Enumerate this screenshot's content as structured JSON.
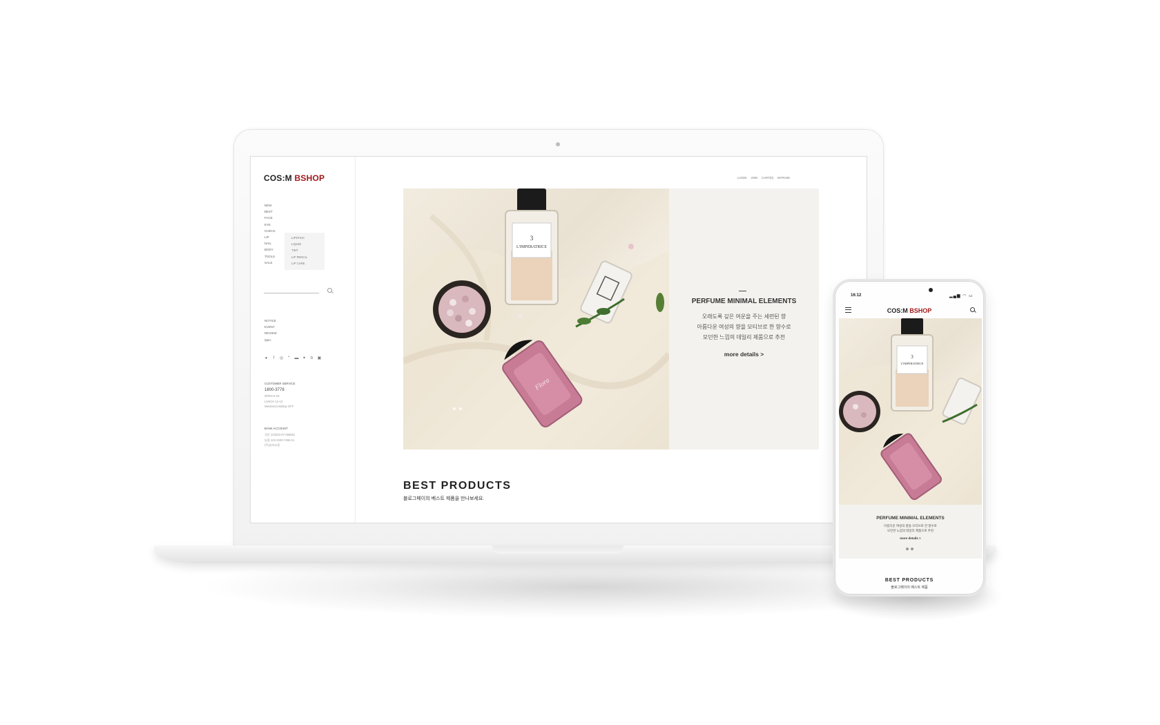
{
  "brand": {
    "part1": "COS:M ",
    "part2": "BSHOP",
    "accent": "#a01818"
  },
  "sidebar": {
    "nav": [
      "NEW",
      "BEST",
      "FACE",
      "EYE",
      "CHECK",
      "LIP",
      "NAIL",
      "BODY",
      "TOOLS",
      "SALE"
    ],
    "lip_submenu": [
      "LIPSTICK",
      "LIQUID",
      "TINT",
      "LIP PENCIL",
      "LIP CARE"
    ],
    "search_icon": "search-icon",
    "nav2": [
      "NOTICE",
      "EVENT",
      "REVIEW",
      "Q&A"
    ],
    "sns_icons": [
      "talk-icon",
      "facebook-icon",
      "instagram-icon",
      "story-icon",
      "blog-icon",
      "twitter-icon",
      "band-icon",
      "youtube-icon"
    ],
    "customer_service_label": "CUSTOMER SERVICE",
    "phone": "1800-3778",
    "hours": [
      "OPEN 9-18",
      "LUNCH 12-13",
      "Weekend,Holiday OFF"
    ],
    "bank_label": "BANK ACCOUNT",
    "bank_lines": [
      "국민 123333-07-255551",
      "농협 123-3330-7255-31",
      "(주)뷰티쇼핑"
    ]
  },
  "topmenu": [
    "LOGIN",
    "JOIN",
    "CART(0)",
    "MYPAGE"
  ],
  "hero": {
    "title": "PERFUME MINIMAL ELEMENTS",
    "lines": [
      "오래도록 깊은 여운을 주는 세련된 향",
      "아름다운 여성의 향을 모티브로 한 향수로",
      "모던한 느낌의 데일리 제품으로 추천"
    ],
    "more": "more details >"
  },
  "best": {
    "title": "BEST PRODUCTS",
    "subtitle": "블로그페이의 베스트 제품을 만나보세요."
  },
  "phone": {
    "time": "16:12",
    "status": "▂▄▆ ◠ ▭",
    "hero_title": "PERFUME MINIMAL ELEMENTS",
    "hero_line1": "아름다운 여성의 향을 모티브로 한 향수로",
    "hero_line2": "모던한 느낌의 데일리 제품으로 추천",
    "more": "more details >",
    "best_title": "BEST PRODUCTS",
    "best_sub": "블로그페이의 베스트 제품"
  }
}
